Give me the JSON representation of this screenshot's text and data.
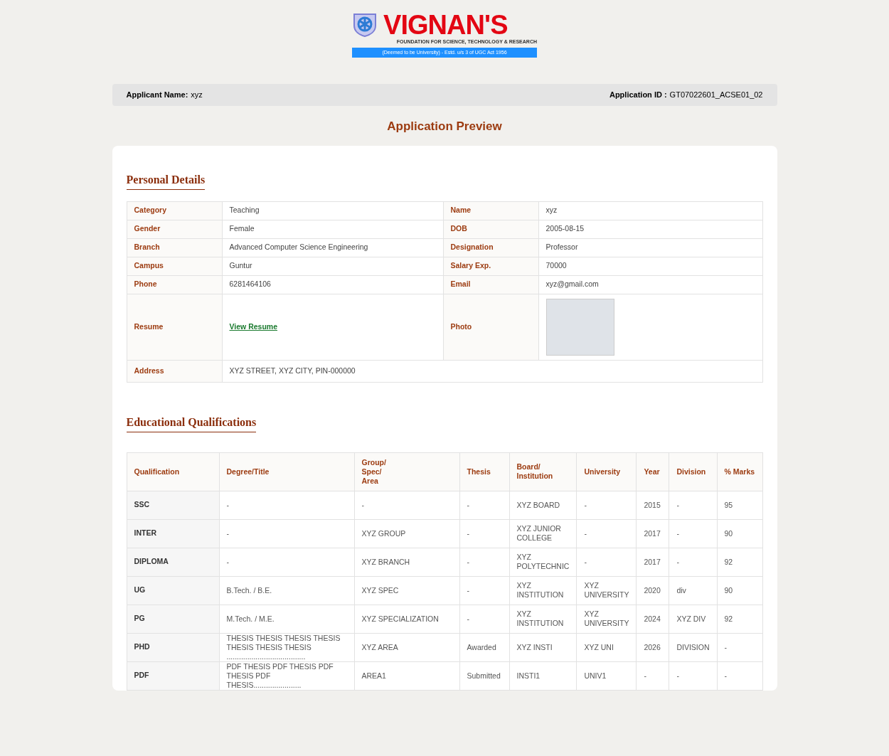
{
  "logo": {
    "name": "VIGNAN'S",
    "subtitle": "FOUNDATION FOR SCIENCE, TECHNOLOGY & RESEARCH",
    "band": "(Deemed to be University) - Estd. u/s 3 of UGC Act 1956"
  },
  "applicant": {
    "name_label": "Applicant Name:",
    "name": "xyz",
    "id_label": "Application ID :",
    "id": "GT07022601_ACSE01_02"
  },
  "title": "Application Preview",
  "personal_details": {
    "heading": "Personal Details",
    "rows": [
      {
        "kind": "pair",
        "label": "Category",
        "value": "Teaching",
        "label2": "Name",
        "value2": "xyz"
      },
      {
        "kind": "pair",
        "label": "Gender",
        "value": "Female",
        "label2": "DOB",
        "value2": "2005-08-15"
      },
      {
        "kind": "pair",
        "label": "Branch",
        "value": "Advanced Computer Science Engineering",
        "label2": "Designation",
        "value2": "Professor"
      },
      {
        "kind": "pair",
        "label": "Campus",
        "value": "Guntur",
        "label2": "Salary Exp.",
        "value2": "70000"
      },
      {
        "kind": "pair",
        "label": "Phone",
        "value": "6281464106",
        "label2": "Email",
        "value2": "xyz@gmail.com"
      },
      {
        "kind": "files",
        "label": "Resume",
        "link": "View Resume",
        "label2": "Photo"
      },
      {
        "kind": "wide",
        "label": "Address",
        "value": "XYZ STREET, XYZ CITY, PIN-000000"
      }
    ]
  },
  "educational_qualifications": {
    "heading": "Educational Qualifications",
    "columns": [
      "Qualification",
      "Degree/Title",
      "Group/\nSpec/\nArea",
      "Thesis",
      "Board/\nInstitution",
      "University",
      "Year",
      "Division",
      "% Marks"
    ],
    "rows": [
      [
        "SSC",
        "-",
        "-",
        "-",
        "XYZ BOARD",
        "-",
        "2015",
        "-",
        "95"
      ],
      [
        "INTER",
        "-",
        "XYZ GROUP",
        "-",
        "XYZ JUNIOR COLLEGE",
        "-",
        "2017",
        "-",
        "90"
      ],
      [
        "DIPLOMA",
        "-",
        "XYZ BRANCH",
        "-",
        "XYZ POLYTECHNIC",
        "-",
        "2017",
        "-",
        "92"
      ],
      [
        "UG",
        "B.Tech. / B.E.",
        "XYZ SPEC",
        "-",
        "XYZ INSTITUTION",
        "XYZ UNIVERSITY",
        "2020",
        "div",
        "90"
      ],
      [
        "PG",
        "M.Tech. / M.E.",
        "XYZ SPECIALIZATION",
        "-",
        "XYZ INSTITUTION",
        "XYZ UNIVERSITY",
        "2024",
        "XYZ DIV",
        "92"
      ],
      [
        "PHD",
        "THESIS THESIS THESIS THESIS THESIS THESIS THESIS ......................................",
        "XYZ AREA",
        "Awarded",
        "XYZ INSTI",
        "XYZ UNI",
        "2026",
        "DIVISION",
        "-"
      ],
      [
        "PDF",
        "PDF THESIS PDF THESIS PDF THESIS PDF THESIS.......................",
        "AREA1",
        "Submitted",
        "INSTI1",
        "UNIV1",
        "-",
        "-",
        "-"
      ]
    ]
  }
}
